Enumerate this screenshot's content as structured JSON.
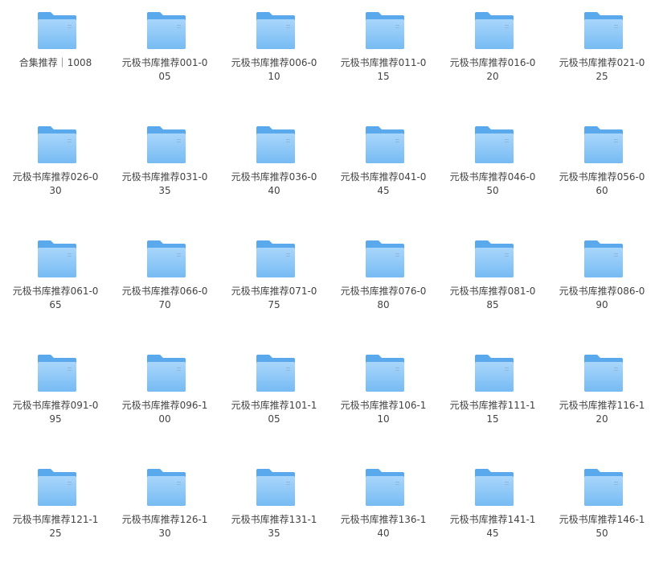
{
  "icon": "folder-icon",
  "colors": {
    "folder_back": "#5aa9ec",
    "folder_front_top": "#a9d6fb",
    "folder_front_bottom": "#76bbf3",
    "folder_mark": "#8fb7da",
    "text": "#444444"
  },
  "items": [
    {
      "label": "合集推荐｜1008"
    },
    {
      "label": "元极书库推荐001-005"
    },
    {
      "label": "元极书库推荐006-010"
    },
    {
      "label": "元极书库推荐011-015"
    },
    {
      "label": "元极书库推荐016-020"
    },
    {
      "label": "元极书库推荐021-025"
    },
    {
      "label": "元极书库推荐026-030"
    },
    {
      "label": "元极书库推荐031-035"
    },
    {
      "label": "元极书库推荐036-040"
    },
    {
      "label": "元极书库推荐041-045"
    },
    {
      "label": "元极书库推荐046-050"
    },
    {
      "label": "元极书库推荐056-060"
    },
    {
      "label": "元极书库推荐061-065"
    },
    {
      "label": "元极书库推荐066-070"
    },
    {
      "label": "元极书库推荐071-075"
    },
    {
      "label": "元极书库推荐076-080"
    },
    {
      "label": "元极书库推荐081-085"
    },
    {
      "label": "元极书库推荐086-090"
    },
    {
      "label": "元极书库推荐091-095"
    },
    {
      "label": "元极书库推荐096-100"
    },
    {
      "label": "元极书库推荐101-105"
    },
    {
      "label": "元极书库推荐106-110"
    },
    {
      "label": "元极书库推荐111-115"
    },
    {
      "label": "元极书库推荐116-120"
    },
    {
      "label": "元极书库推荐121-125"
    },
    {
      "label": "元极书库推荐126-130"
    },
    {
      "label": "元极书库推荐131-135"
    },
    {
      "label": "元极书库推荐136-140"
    },
    {
      "label": "元极书库推荐141-145"
    },
    {
      "label": "元极书库推荐146-150"
    }
  ]
}
